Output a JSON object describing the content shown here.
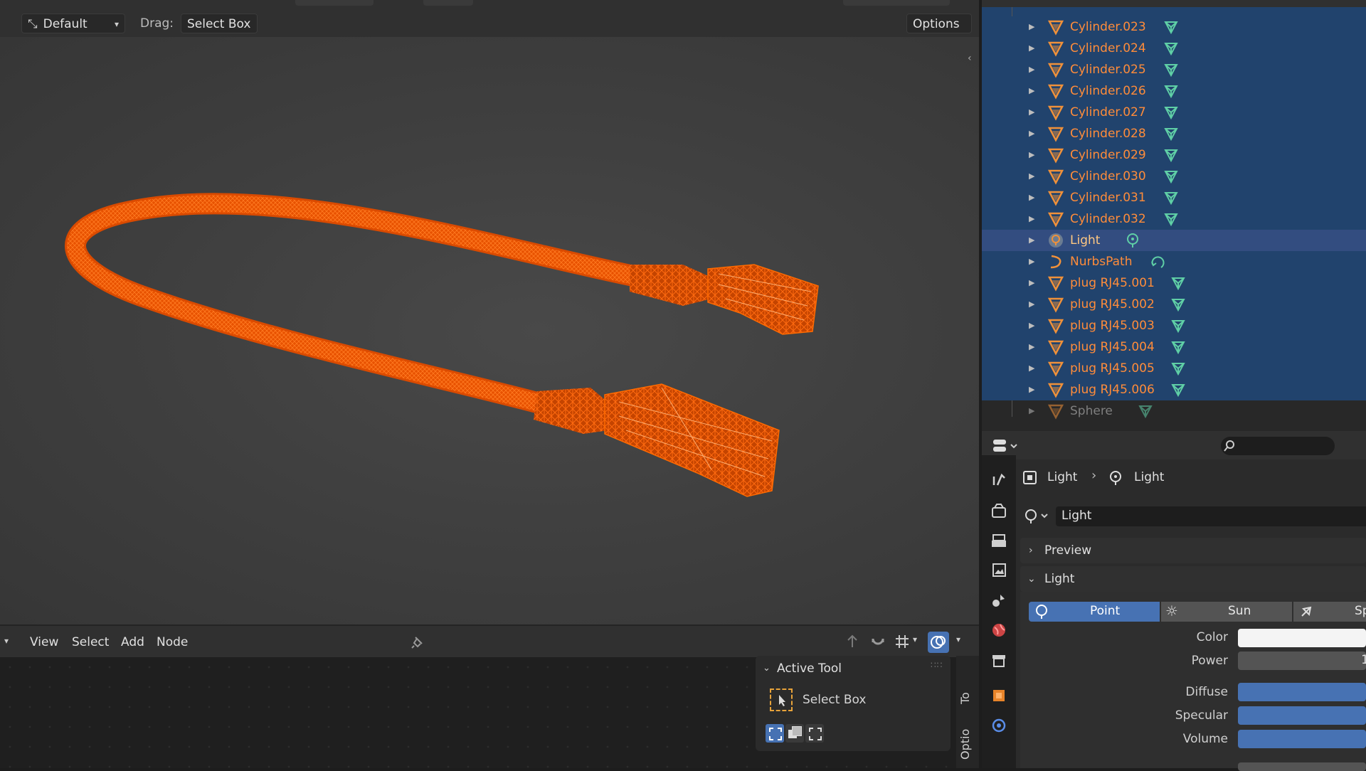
{
  "viewport_header": {
    "orientation_label": "Default",
    "drag_label": "Drag:",
    "drag_value": "Select Box",
    "options_label": "Options"
  },
  "node_editor": {
    "menu": [
      "View",
      "Select",
      "Add",
      "Node"
    ]
  },
  "active_tool_panel": {
    "title": "Active Tool",
    "tool_name": "Select Box"
  },
  "side_tabs": [
    "To",
    "Optio"
  ],
  "outliner": {
    "items": [
      {
        "name": "Cylinder.023",
        "type": "mesh",
        "selected": true
      },
      {
        "name": "Cylinder.024",
        "type": "mesh",
        "selected": true
      },
      {
        "name": "Cylinder.025",
        "type": "mesh",
        "selected": true
      },
      {
        "name": "Cylinder.026",
        "type": "mesh",
        "selected": true
      },
      {
        "name": "Cylinder.027",
        "type": "mesh",
        "selected": true
      },
      {
        "name": "Cylinder.028",
        "type": "mesh",
        "selected": true
      },
      {
        "name": "Cylinder.029",
        "type": "mesh",
        "selected": true
      },
      {
        "name": "Cylinder.030",
        "type": "mesh",
        "selected": true
      },
      {
        "name": "Cylinder.031",
        "type": "mesh",
        "selected": true
      },
      {
        "name": "Cylinder.032",
        "type": "mesh",
        "selected": true
      },
      {
        "name": "Light",
        "type": "light",
        "selected": true,
        "active": true
      },
      {
        "name": "NurbsPath",
        "type": "curve",
        "selected": true
      },
      {
        "name": "plug RJ45.001",
        "type": "mesh",
        "selected": true
      },
      {
        "name": "plug RJ45.002",
        "type": "mesh",
        "selected": true
      },
      {
        "name": "plug RJ45.003",
        "type": "mesh",
        "selected": true
      },
      {
        "name": "plug RJ45.004",
        "type": "mesh",
        "selected": true
      },
      {
        "name": "plug RJ45.005",
        "type": "mesh",
        "selected": true
      },
      {
        "name": "plug RJ45.006",
        "type": "mesh",
        "selected": true
      },
      {
        "name": "Sphere",
        "type": "mesh",
        "selected": false
      }
    ]
  },
  "properties": {
    "breadcrumb": [
      "Light",
      "Light"
    ],
    "datablock_name": "Light",
    "sections": {
      "preview": "Preview",
      "light": "Light"
    },
    "light_types": [
      "Point",
      "Sun",
      "Sp"
    ],
    "active_light_type": "Point",
    "fields": {
      "color_label": "Color",
      "power_label": "Power",
      "power_value": "1",
      "diffuse_label": "Diffuse",
      "specular_label": "Specular",
      "volume_label": "Volume"
    }
  },
  "colors": {
    "accent_blue": "#4772b3",
    "selected_row": "#21436d",
    "active_row": "#334d80",
    "object_orange": "#ff7a1a",
    "mesh_icon_green": "#5fcfa6",
    "wire_orange": "#ff5a00"
  }
}
